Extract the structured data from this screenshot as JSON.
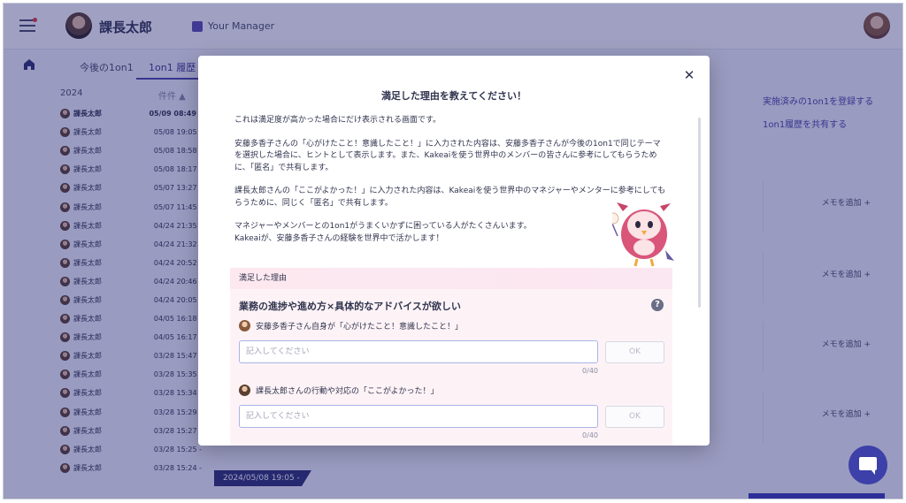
{
  "header": {
    "user_name": "課長太郎",
    "manager_label": "Your Manager"
  },
  "tabs": {
    "upcoming": "今後の1on1",
    "history": "1on1 履歴"
  },
  "history": {
    "year": "2024",
    "count_label": "件件 ▲",
    "rows": [
      {
        "name": "課長太郎",
        "date": "05/09 08:49 -"
      },
      {
        "name": "課長太郎",
        "date": "05/08 19:05 -"
      },
      {
        "name": "課長太郎",
        "date": "05/08 18:58 -"
      },
      {
        "name": "課長太郎",
        "date": "05/08 18:17 -"
      },
      {
        "name": "課長太郎",
        "date": "05/07 13:27 -"
      },
      {
        "name": "課長太郎",
        "date": "05/07 11:45 -"
      },
      {
        "name": "課長太郎",
        "date": "04/24 21:35 -"
      },
      {
        "name": "課長太郎",
        "date": "04/24 21:32 -"
      },
      {
        "name": "課長太郎",
        "date": "04/24 20:52 -"
      },
      {
        "name": "課長太郎",
        "date": "04/24 20:46 -"
      },
      {
        "name": "課長太郎",
        "date": "04/24 20:05 -"
      },
      {
        "name": "課長太郎",
        "date": "04/05 16:18 -"
      },
      {
        "name": "課長太郎",
        "date": "04/05 16:17 -"
      },
      {
        "name": "課長太郎",
        "date": "03/28 15:47 -"
      },
      {
        "name": "課長太郎",
        "date": "03/28 15:35 -"
      },
      {
        "name": "課長太郎",
        "date": "03/28 15:34 -"
      },
      {
        "name": "課長太郎",
        "date": "03/28 15:29 -"
      },
      {
        "name": "課長太郎",
        "date": "03/28 15:27 -"
      },
      {
        "name": "課長太郎",
        "date": "03/28 15:25 -"
      },
      {
        "name": "課長太郎",
        "date": "03/28 15:24 -"
      }
    ]
  },
  "actions": {
    "register": "実施済みの1on1を登録する",
    "share": "1on1履歴を共有する",
    "memo": "メモを追加 +"
  },
  "date_tag": "2024/05/08 19:05 -",
  "modal": {
    "title": "満足した理由を教えてください！",
    "p1": "これは満足度が高かった場合にだけ表示される画面です。",
    "p2": "安藤多香子さんの「心がけたこと！意識したこと！」に入力された内容は、安藤多香子さんが今後の1on1で同じテーマを選択した場合に、ヒントとして表示します。また、Kakeaiを使う世界中のメンバーの皆さんに参考にしてもらうために、「匿名」で共有します。",
    "p3": "課長太郎さんの「ここがよかった！」に入力された内容は、Kakeaiを使う世界中のマネジャーやメンターに参考にしてもらうために、同じく「匿名」で共有します。",
    "p4a": "マネジャーやメンバーとの1on1がうまくいかずに困っている人がたくさんいます。",
    "p4b": "Kakeaiが、安藤多香子さんの経験を世界中で活かします！",
    "reason_band": "満足した理由",
    "reason_heading": "業務の進捗や進め方×具体的なアドバイスが欲しい",
    "q1_label": "安藤多香子さん自身が「心がけたこと！意識したこと！」",
    "q2_label": "課長太郎さんの行動や対応の「ここがよかった！」",
    "placeholder": "記入してください",
    "ok": "OK",
    "counter": "0/40"
  }
}
